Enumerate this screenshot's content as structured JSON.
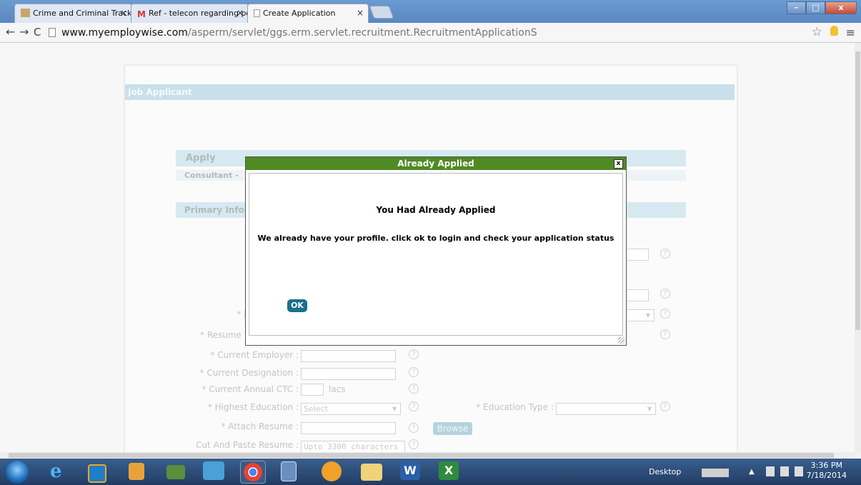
{
  "browser": {
    "tabs": [
      {
        "label": "Crime and Criminal Track",
        "active": false
      },
      {
        "label": "Ref - telecon regarding po",
        "active": false
      },
      {
        "label": "Create Application",
        "active": true
      }
    ],
    "url_domain": "www.myemploywise.com",
    "url_path": "/asperm/servlet/ggs.erm.servlet.recruitment.RecruitmentApplicationS"
  },
  "page": {
    "header": "Job Applicant",
    "apply_section": "Apply",
    "consultant_label": "Consultant -",
    "primary_section": "Primary Infor",
    "form": {
      "resume_label": "* Resume",
      "current_employer": "* Current Employer :",
      "current_designation": "* Current Designation :",
      "current_ctc": "* Current Annual CTC :",
      "ctc_unit": "lacs",
      "highest_education": "* Highest Education :",
      "highest_education_value": "Select",
      "education_type": "* Education Type :",
      "attach_resume": "* Attach Resume :",
      "browse_label": "Browse",
      "cut_paste": "Cut And Paste Resume :",
      "cut_paste_placeholder": "Upto 3300 characters",
      "star_prefix": "* [",
      "help": "?"
    }
  },
  "modal": {
    "title": "Already Applied",
    "close": "x",
    "heading": "You Had Already Applied",
    "message": "We already have your profile. click ok to login and check your application status",
    "ok_label": "OK"
  },
  "taskbar": {
    "desktop_label": "Desktop",
    "time": "3:36 PM",
    "date": "7/18/2014"
  }
}
